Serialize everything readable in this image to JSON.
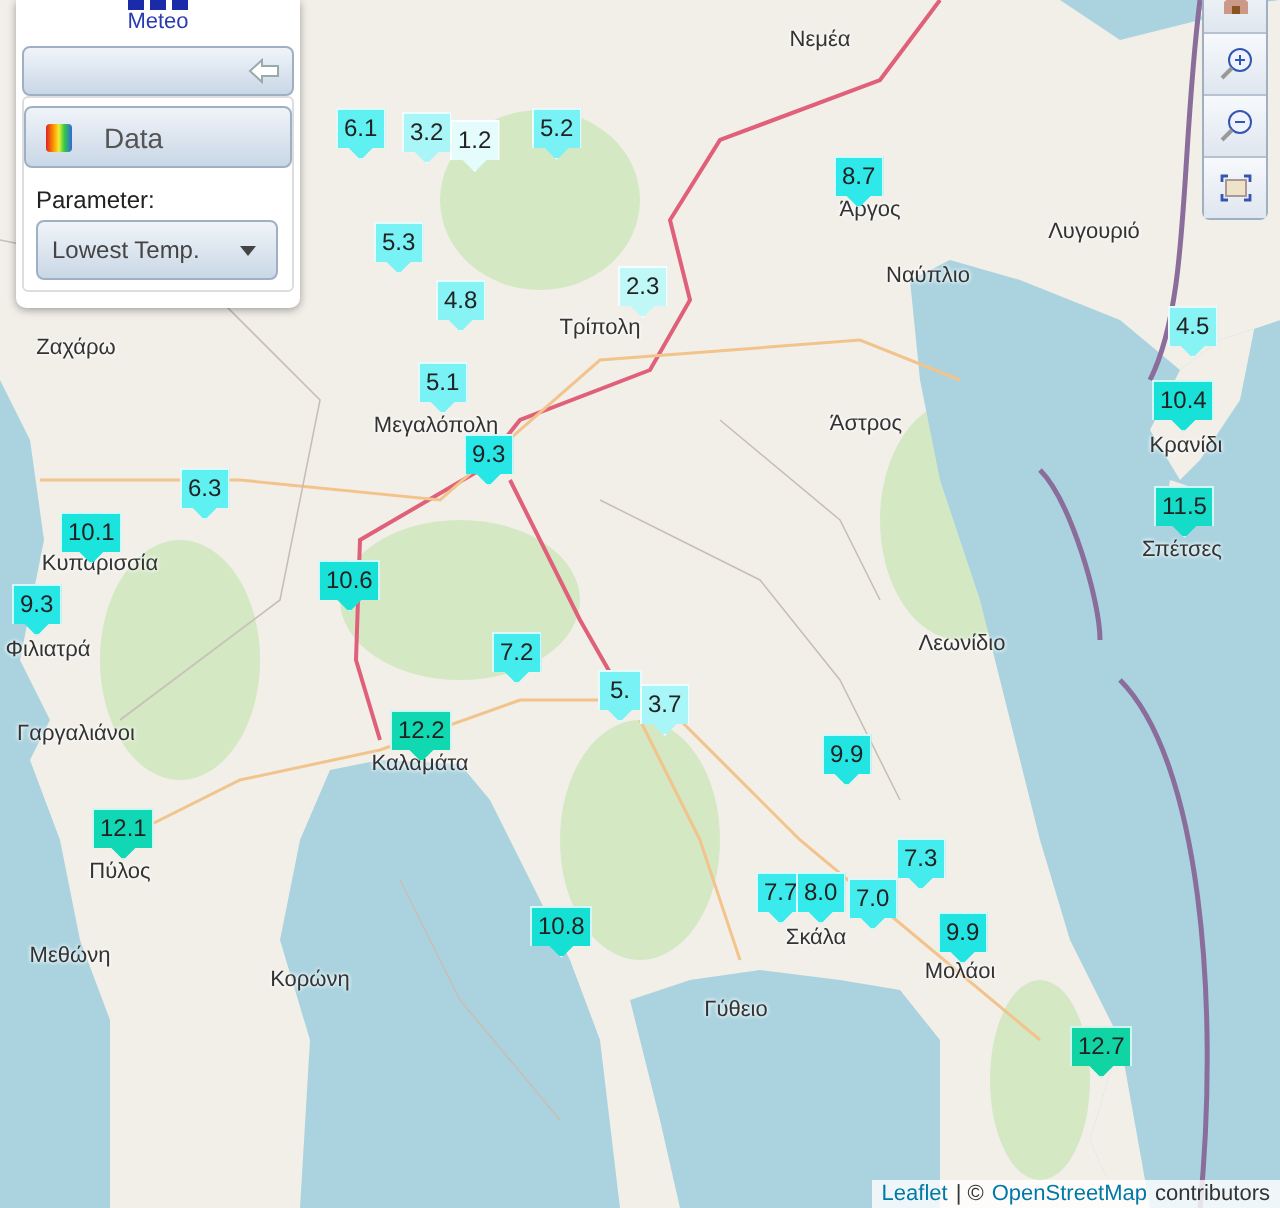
{
  "panel": {
    "logo_text": "Meteo",
    "data_button": "Data",
    "parameter_label": "Parameter:",
    "parameter_select": "Lowest Temp."
  },
  "map": {
    "places": [
      {
        "name": "Νεμέα"
      },
      {
        "name": "Άργος"
      },
      {
        "name": "Ναύπλιο"
      },
      {
        "name": "Λυγουριό"
      },
      {
        "name": "Τρίπολη"
      },
      {
        "name": "Ζαχάρω"
      },
      {
        "name": "Μεγαλόπολη"
      },
      {
        "name": "Άστρος"
      },
      {
        "name": "Κρανίδι"
      },
      {
        "name": "Σπέτσες"
      },
      {
        "name": "Κυπαρισσία"
      },
      {
        "name": "Φιλιατρά"
      },
      {
        "name": "Λεωνίδιο"
      },
      {
        "name": "Γαργαλιάνοι"
      },
      {
        "name": "Καλαμάτα"
      },
      {
        "name": "Πύλος"
      },
      {
        "name": "Μεθώνη"
      },
      {
        "name": "Κορώνη"
      },
      {
        "name": "Σκάλα"
      },
      {
        "name": "Μολάοι"
      },
      {
        "name": "Γύθειο"
      }
    ],
    "markers": [
      {
        "value": "6.1",
        "color": "#5ff0f2"
      },
      {
        "value": "3.2",
        "color": "#a8f6f8"
      },
      {
        "value": "1.2",
        "color": "#e4fcfc"
      },
      {
        "value": "5.2",
        "color": "#78f2f4"
      },
      {
        "value": "8.7",
        "color": "#2ee8ea"
      },
      {
        "value": "5.3",
        "color": "#78f2f4"
      },
      {
        "value": "4.8",
        "color": "#88f3f5"
      },
      {
        "value": "2.3",
        "color": "#c0f8f8"
      },
      {
        "value": "4.5",
        "color": "#88f3f5"
      },
      {
        "value": "5.1",
        "color": "#78f2f4"
      },
      {
        "value": "10.4",
        "color": "#18e2d8"
      },
      {
        "value": "9.3",
        "color": "#26e6e6"
      },
      {
        "value": "6.3",
        "color": "#5ff0f2"
      },
      {
        "value": "11.5",
        "color": "#14dcc8"
      },
      {
        "value": "10.1",
        "color": "#1ae4dc"
      },
      {
        "value": "10.6",
        "color": "#18e2d8"
      },
      {
        "value": "9.3",
        "color": "#26e6e6"
      },
      {
        "value": "7.2",
        "color": "#44ecee"
      },
      {
        "value": "5.",
        "color": "#78f2f4"
      },
      {
        "value": "3.7",
        "color": "#a8f6f8"
      },
      {
        "value": "12.2",
        "color": "#10d8b0"
      },
      {
        "value": "9.9",
        "color": "#22e4e2"
      },
      {
        "value": "12.1",
        "color": "#10d8b4"
      },
      {
        "value": "7.3",
        "color": "#44ecee"
      },
      {
        "value": "7.7",
        "color": "#3aeaec"
      },
      {
        "value": "8.0",
        "color": "#34eaea"
      },
      {
        "value": "7.0",
        "color": "#44ecee"
      },
      {
        "value": "9.9",
        "color": "#22e4e2"
      },
      {
        "value": "10.8",
        "color": "#16e0d4"
      },
      {
        "value": "12.7",
        "color": "#10d4a4"
      }
    ]
  },
  "attribution": {
    "leaflet_link": "Leaflet",
    "separator": "| ©",
    "osm_link": "OpenStreetMap",
    "suffix": "contributors"
  }
}
